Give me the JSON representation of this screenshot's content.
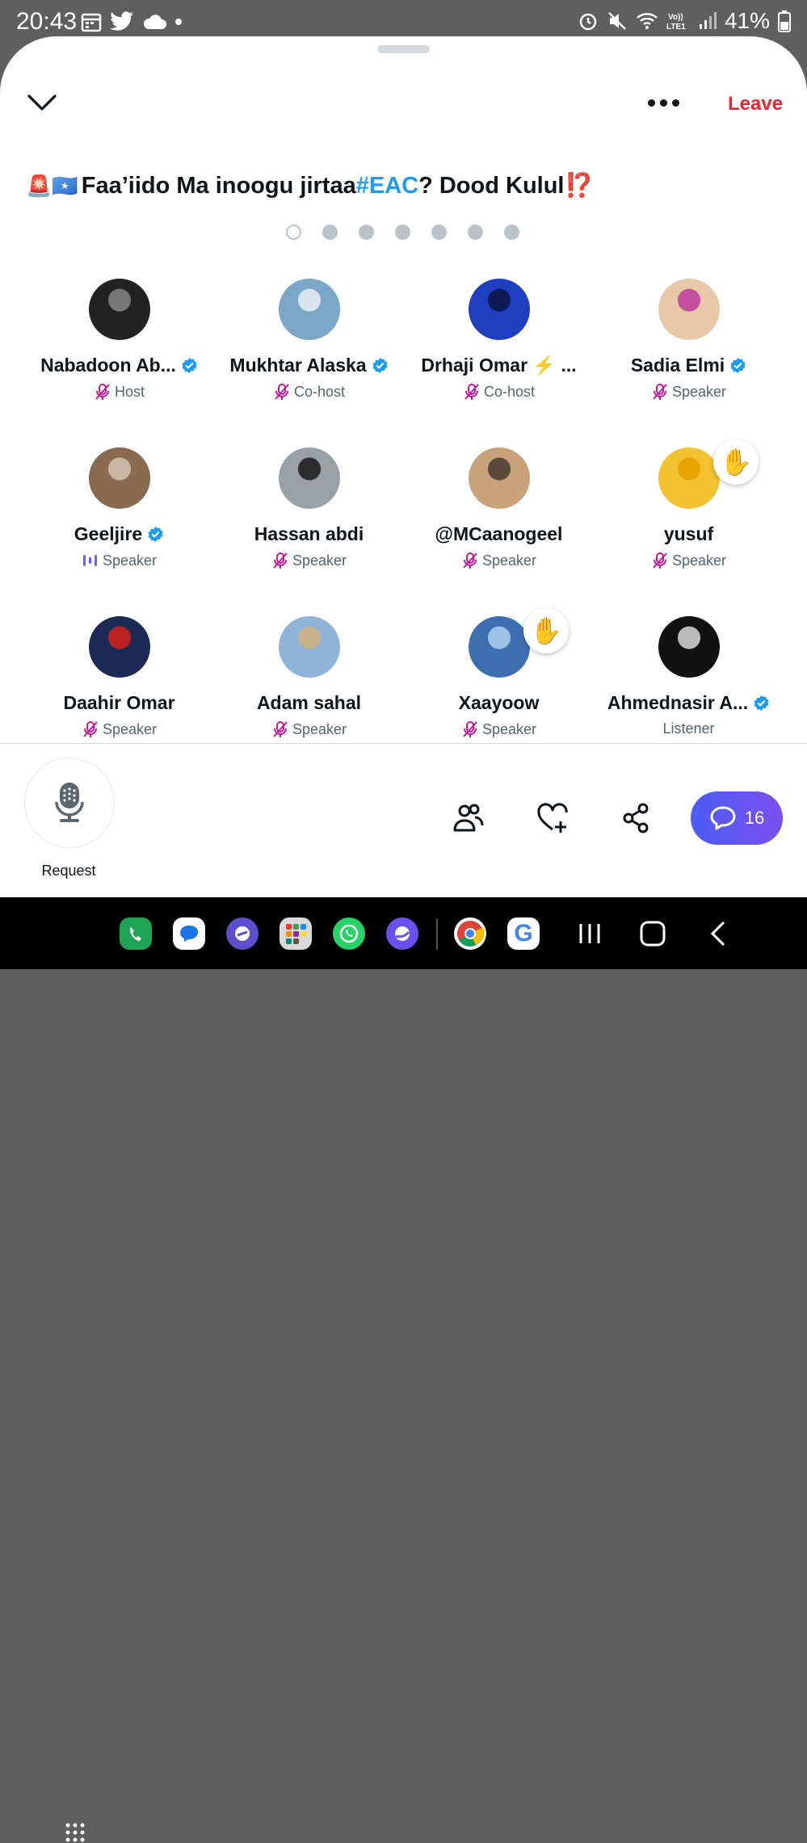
{
  "status_bar": {
    "time": "20:43",
    "battery": "41%"
  },
  "header": {
    "leave_label": "Leave"
  },
  "space": {
    "title_prefix": "Faa’iido Ma inoogu jirtaa ",
    "hashtag": "#EAC",
    "title_suffix": "? Dood Kulul",
    "title_emoji_start": "🚨🇸🇴",
    "title_emoji_end": "⁉️"
  },
  "pager": {
    "count": 7,
    "active": 0
  },
  "participants": [
    {
      "name": "Nabadoon Ab...",
      "role": "Host",
      "verified": true,
      "mic": "muted"
    },
    {
      "name": "Mukhtar Alaska",
      "role": "Co-host",
      "verified": true,
      "mic": "muted"
    },
    {
      "name": "Drhaji Omar ⚡ ...",
      "role": "Co-host",
      "verified": false,
      "mic": "muted"
    },
    {
      "name": "Sadia Elmi",
      "role": "Speaker",
      "verified": true,
      "mic": "muted"
    },
    {
      "name": "Geeljire",
      "role": "Speaker",
      "verified": true,
      "mic": "speaking"
    },
    {
      "name": "Hassan abdi",
      "role": "Speaker",
      "verified": false,
      "mic": "muted"
    },
    {
      "name": "@MCaanogeel",
      "role": "Speaker",
      "verified": false,
      "mic": "muted"
    },
    {
      "name": "yusuf",
      "role": "Speaker",
      "verified": false,
      "mic": "muted",
      "hand_raised": true
    },
    {
      "name": "Daahir Omar",
      "role": "Speaker",
      "verified": false,
      "mic": "muted"
    },
    {
      "name": "Adam sahal",
      "role": "Speaker",
      "verified": false,
      "mic": "muted"
    },
    {
      "name": "Xaayoow",
      "role": "Speaker",
      "verified": false,
      "mic": "muted",
      "hand_raised": true
    },
    {
      "name": "Ahmednasir A...",
      "role": "Listener",
      "verified": true,
      "mic": "none"
    }
  ],
  "bottom": {
    "request_label": "Request",
    "comment_count": "16"
  },
  "colors": {
    "accent": "#1d9bf0",
    "leave": "#f4212e",
    "mute": "#c2189b",
    "speaking": "#7856ff"
  },
  "icons": [
    "collapse-chevron-icon",
    "more-icon",
    "microphone-icon",
    "people-icon",
    "heart-plus-icon",
    "share-icon",
    "comment-icon"
  ]
}
